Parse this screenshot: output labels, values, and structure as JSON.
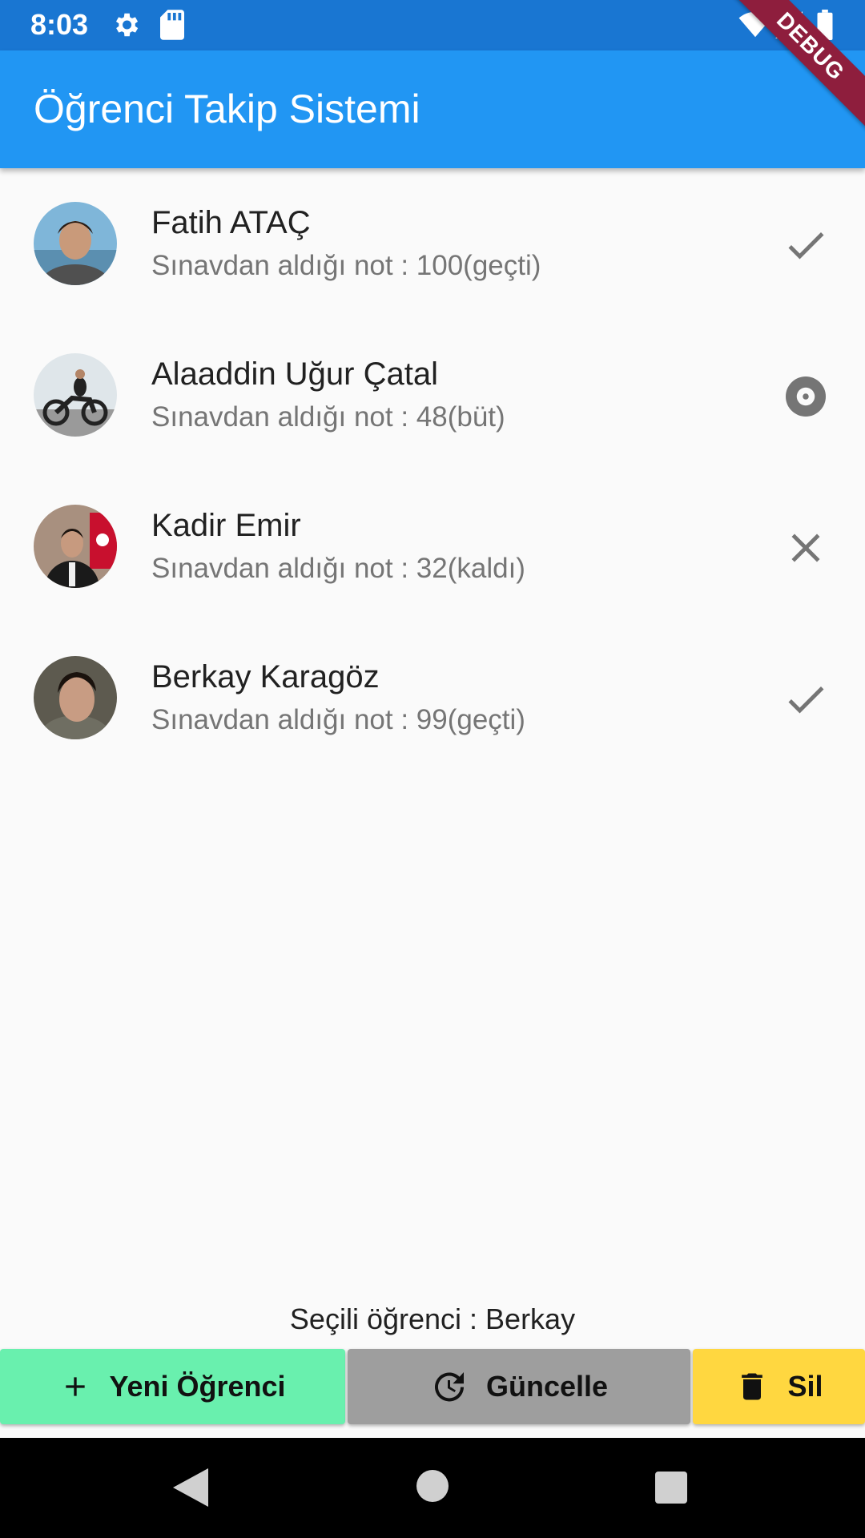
{
  "status_bar": {
    "time": "8:03"
  },
  "app_bar": {
    "title": "Öğrenci Takip Sistemi",
    "debug_label": "DEBUG"
  },
  "students": [
    {
      "name": "Fatih ATAÇ",
      "grade_text": "Sınavdan aldığı not : 100(geçti)",
      "status_icon": "check-icon"
    },
    {
      "name": "Alaaddin Uğur Çatal",
      "grade_text": "Sınavdan aldığı not : 48(büt)",
      "status_icon": "album-icon"
    },
    {
      "name": "Kadir Emir",
      "grade_text": "Sınavdan aldığı not : 32(kaldı)",
      "status_icon": "close-icon"
    },
    {
      "name": "Berkay Karagöz",
      "grade_text": "Sınavdan aldığı not : 99(geçti)",
      "status_icon": "check-icon"
    }
  ],
  "selected": {
    "text": "Seçili öğrenci : Berkay"
  },
  "buttons": {
    "add_label": "Yeni Öğrenci",
    "update_label": "Güncelle",
    "delete_label": "Sil"
  },
  "colors": {
    "status_bar": "#1976d2",
    "app_bar": "#2196f3",
    "add_button": "#69f0ae",
    "update_button": "#9e9e9e",
    "delete_button": "#ffd740"
  }
}
